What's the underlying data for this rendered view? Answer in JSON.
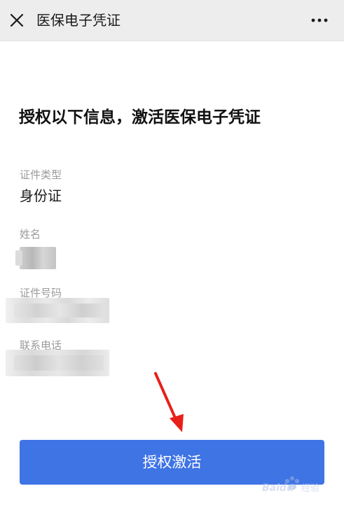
{
  "navbar": {
    "title": "医保电子凭证",
    "close_icon": "close-icon",
    "more_icon": "more-horizontal-icon"
  },
  "heading": "授权以下信息，激活医保电子凭证",
  "fields": {
    "id_type": {
      "label": "证件类型",
      "value": "身份证"
    },
    "name": {
      "label": "姓名"
    },
    "id_number": {
      "label": "证件号码"
    },
    "phone": {
      "label": "联系电话"
    }
  },
  "activate_button": {
    "label": "授权激活"
  },
  "colors": {
    "accent": "#3f74e5",
    "arrow": "#e8201a",
    "navbar_bg": "#ededed"
  },
  "watermark": {
    "brand": "Baidu",
    "text": "经验"
  }
}
